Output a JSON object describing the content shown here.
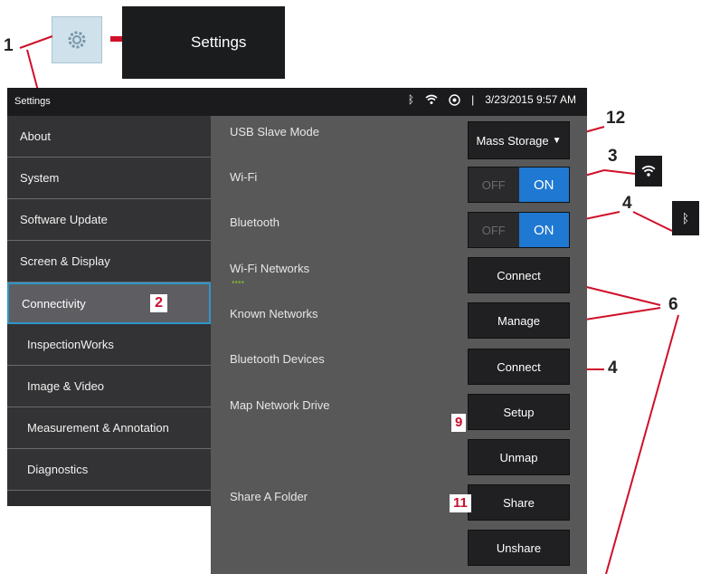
{
  "top": {
    "callout_1": "1",
    "settings_tile_label": "Settings",
    "gear_icon": "gear-icon",
    "arrow_color": "#d0102a"
  },
  "status_bar": {
    "title": "Settings",
    "datetime": "3/23/2015 9:57 AM",
    "separator": "|",
    "icons": [
      "bluetooth-icon",
      "wifi-icon",
      "usb-icon"
    ]
  },
  "sidebar": {
    "items": [
      {
        "label": "About"
      },
      {
        "label": "System"
      },
      {
        "label": "Software Update"
      },
      {
        "label": "Screen & Display"
      },
      {
        "label": "Connectivity",
        "badge": "2",
        "active": true
      },
      {
        "label": "InspectionWorks"
      },
      {
        "label": "Image & Video"
      },
      {
        "label": "Measurement & Annotation"
      },
      {
        "label": "Diagnostics"
      }
    ]
  },
  "panel": {
    "usb_label": "USB Slave Mode",
    "usb_value": "Mass Storage",
    "wifi_label": "Wi-Fi",
    "wifi_off": "OFF",
    "wifi_on": "ON",
    "bt_label": "Bluetooth",
    "bt_off": "OFF",
    "bt_on": "ON",
    "wifi_networks_label": "Wi-Fi Networks",
    "wifi_connect": "Connect",
    "known_networks_label": "Known Networks",
    "known_manage": "Manage",
    "bt_devices_label": "Bluetooth Devices",
    "bt_connect": "Connect",
    "map_drive_label": "Map Network Drive",
    "map_setup": "Setup",
    "map_unmap": "Unmap",
    "share_label": "Share A Folder",
    "share_share": "Share",
    "share_unshare": "Unshare"
  },
  "callouts": {
    "c12": "12",
    "c3": "3",
    "c4a": "4",
    "c6": "6",
    "c4b": "4",
    "c9": "9",
    "c11": "11"
  },
  "colors": {
    "accent_blue": "#1f78d1",
    "callout_red": "#c8102e",
    "selection_border": "#2f95c9"
  }
}
